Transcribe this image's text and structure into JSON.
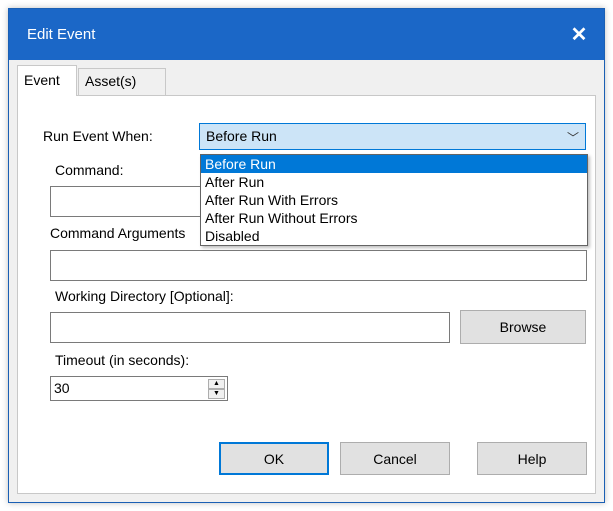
{
  "window": {
    "title": "Edit Event",
    "close_glyph": "✕",
    "accent_color": "#1b67c7"
  },
  "tabs": [
    {
      "label": "Event",
      "active": true
    },
    {
      "label": "Asset(s)",
      "active": false
    }
  ],
  "run_event": {
    "label": "Run Event When:",
    "value": "Before Run",
    "arrow_glyph": "﹀",
    "options": [
      "Before Run",
      "After Run",
      "After Run With Errors",
      "After Run Without Errors",
      "Disabled"
    ],
    "selected_index": 0
  },
  "command": {
    "label": "Command:",
    "value": ""
  },
  "command_arguments": {
    "label": "Command Arguments",
    "value": ""
  },
  "working_directory": {
    "label": "Working Directory [Optional]:",
    "value": "",
    "browse_label": "Browse"
  },
  "timeout": {
    "label": "Timeout (in seconds):",
    "value": "30",
    "up_glyph": "▲",
    "down_glyph": "▼"
  },
  "buttons": {
    "ok": "OK",
    "cancel": "Cancel",
    "help": "Help"
  }
}
